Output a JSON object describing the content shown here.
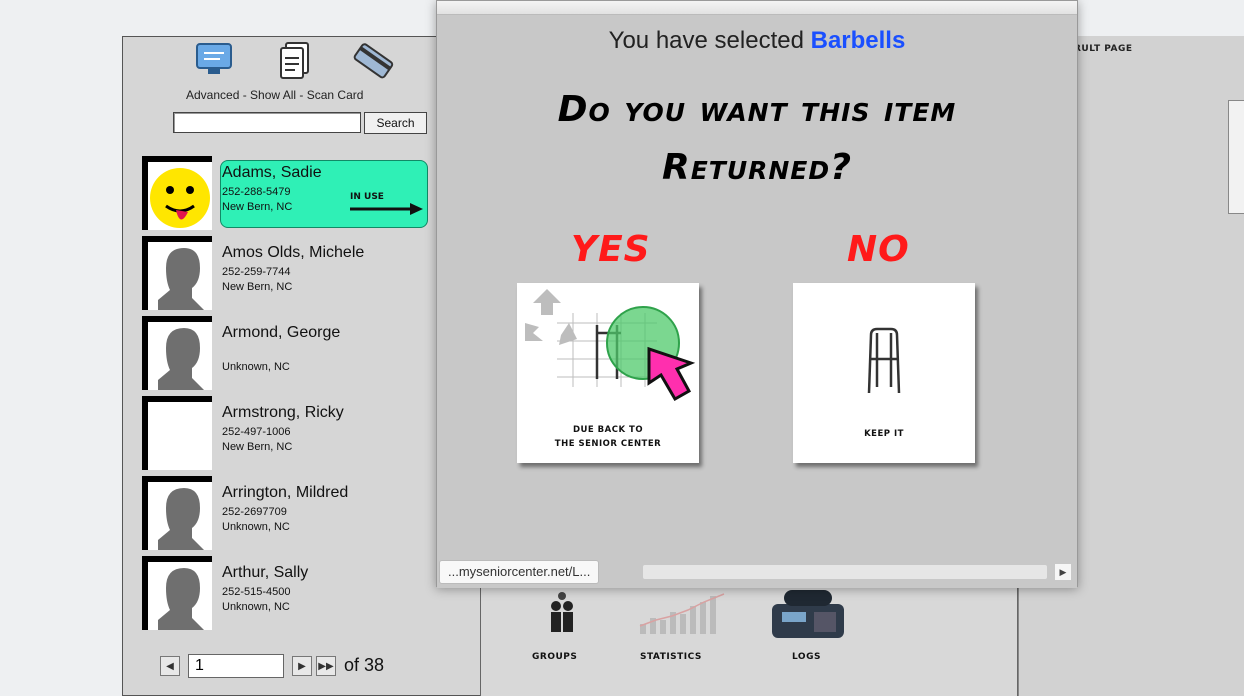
{
  "toolbar": {
    "caption": "Advanced - Show All - Scan Card",
    "icons": [
      "monitor-icon",
      "document-icon",
      "card-scanner-icon"
    ],
    "search_label": "Search",
    "search_value": ""
  },
  "contacts": [
    {
      "name": "Adams, Sadie",
      "phone": "252-288-5479",
      "city": "New Bern, NC",
      "selected": true,
      "status": "IN USE"
    },
    {
      "name": "Amos Olds, Michele",
      "phone": "252-259-7744",
      "city": "New Bern, NC"
    },
    {
      "name": "Armond, George",
      "phone": "",
      "city": "Unknown, NC"
    },
    {
      "name": "Armstrong, Ricky",
      "phone": "252-497-1006",
      "city": "New Bern, NC"
    },
    {
      "name": "Arrington, Mildred",
      "phone": "252-2697709",
      "city": "Unknown, NC"
    },
    {
      "name": "Arthur, Sally",
      "phone": "252-515-4500",
      "city": "Unknown, NC"
    }
  ],
  "pager": {
    "current": "1",
    "total_text": "of 38"
  },
  "right_panel": {
    "label": "RULT PAGE"
  },
  "bottom_nav": {
    "groups": "GROUPS",
    "statistics": "STATISTICS",
    "logs": "LOGS"
  },
  "modal": {
    "selected_prefix": "You have selected",
    "selected_item": "Barbells",
    "question_line1": "Do you want this item",
    "question_line2": "Returned?",
    "yes_label": "YES",
    "no_label": "NO",
    "yes_text_line1": "DUE BACK TO",
    "yes_text_line2": "THE SENIOR CENTER",
    "no_text": "KEEP IT",
    "status_url": "...myseniorcenter.net/L..."
  },
  "colors": {
    "selected_bg": "#2ff0b6",
    "choice_red": "#ff1a1a",
    "item_blue": "#1a4fff"
  }
}
